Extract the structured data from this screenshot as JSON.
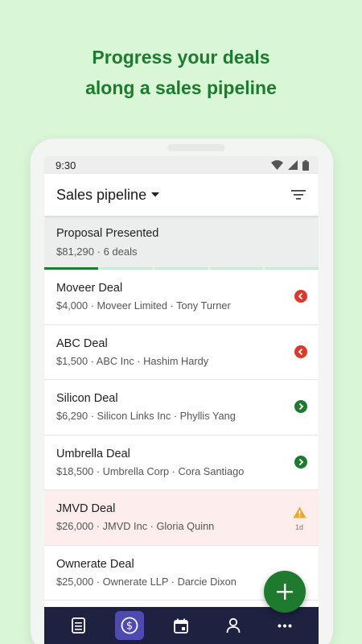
{
  "promo": {
    "line1": "Progress your deals",
    "line2": "along a sales pipeline"
  },
  "status_bar": {
    "time": "9:30",
    "icons": [
      "wifi-icon",
      "signal-icon",
      "battery-icon"
    ]
  },
  "app_bar": {
    "title": "Sales pipeline",
    "dropdown_icon": "caret-down-icon",
    "filter_icon": "filter-icon"
  },
  "stage": {
    "name": "Proposal Presented",
    "value": "$81,290",
    "separator": "·",
    "count": "6 deals",
    "progress_segments": 5,
    "active_segment": 1
  },
  "deals": [
    {
      "name": "Moveer Deal",
      "meta": "$4,000 · Moveer Limited · Tony Turner",
      "status": "back",
      "status_icon": "move-back-icon",
      "color": "#d93a2b"
    },
    {
      "name": "ABC Deal",
      "meta": "$1,500 · ABC Inc · Hashim Hardy",
      "status": "back",
      "status_icon": "move-back-icon",
      "color": "#d93a2b"
    },
    {
      "name": "Silicon Deal",
      "meta": "$6,290 · Silicon Links Inc · Phyllis Yang",
      "status": "forward",
      "status_icon": "move-forward-icon",
      "color": "#1e7a2e"
    },
    {
      "name": "Umbrella Deal",
      "meta": "$18,500 · Umbrella Corp · Cora Santiago",
      "status": "forward",
      "status_icon": "move-forward-icon",
      "color": "#1e7a2e"
    },
    {
      "name": "JMVD Deal",
      "meta": "$26,000 · JMVD Inc · Gloria Quinn",
      "status": "warning",
      "status_icon": "warning-icon",
      "age": "1d",
      "color": "#f0a820"
    },
    {
      "name": "Ownerate Deal",
      "meta": "$25,000 · Ownerate LLP · Darcie Dixon",
      "status": "none"
    }
  ],
  "fab": {
    "icon": "plus-icon",
    "color": "#1e7a2e"
  },
  "bottom_nav": [
    {
      "icon": "activities-icon",
      "active": false
    },
    {
      "icon": "deals-dollar-icon",
      "active": true
    },
    {
      "icon": "calendar-icon",
      "active": false
    },
    {
      "icon": "contacts-person-icon",
      "active": false
    },
    {
      "icon": "more-icon",
      "active": false
    }
  ],
  "colors": {
    "background": "#d9f7d6",
    "brand_green": "#1e7a2e",
    "nav_bg": "#1e2140",
    "nav_active": "#4e4ab0",
    "alert_row": "#fdeeed"
  }
}
